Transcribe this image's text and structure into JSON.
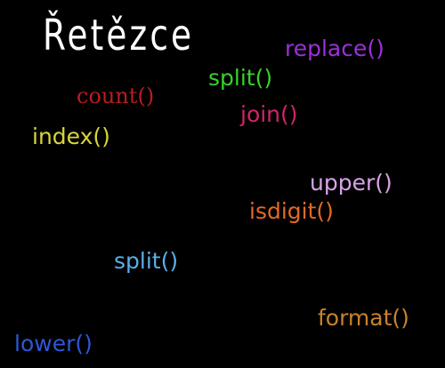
{
  "title": "Řetězce",
  "words": {
    "replace": {
      "text": "replace()",
      "color": "#9b30d9"
    },
    "split_top": {
      "text": "split()",
      "color": "#39d12f"
    },
    "count": {
      "text": "count()",
      "color": "#b81d1d"
    },
    "join": {
      "text": "join()",
      "color": "#d0246a"
    },
    "index": {
      "text": "index()",
      "color": "#d8d43a"
    },
    "upper": {
      "text": "upper()",
      "color": "#d7a2e8"
    },
    "isdigit": {
      "text": "isdigit()",
      "color": "#e06a26"
    },
    "split_bottom": {
      "text": "split()",
      "color": "#5aaee8"
    },
    "format": {
      "text": "format()",
      "color": "#c9822d"
    },
    "lower": {
      "text": "lower()",
      "color": "#2f56d6"
    }
  }
}
